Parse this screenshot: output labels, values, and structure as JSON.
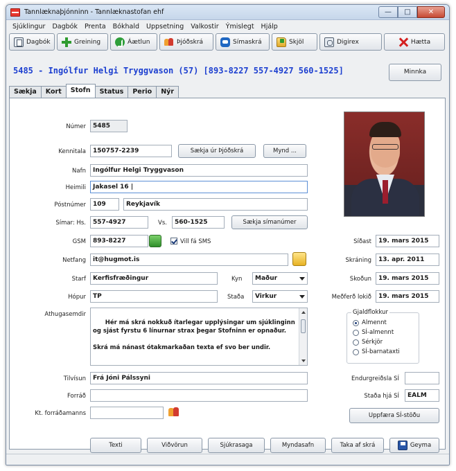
{
  "window": {
    "title": "Tannlæknaþjónninn - Tannlæknastofan ehf",
    "min": "—",
    "max": "□",
    "close": "✕"
  },
  "menu": [
    "Sjúklingur",
    "Dagbók",
    "Prenta",
    "Bókhald",
    "Uppsetning",
    "Valkostir",
    "Ýmislegt",
    "Hjálp"
  ],
  "toolbar": {
    "dagbok": "Dagbók",
    "greining": "Greining",
    "aaetlun": "Áætlun",
    "thjodskra": "Þjóðskrá",
    "simaskra": "Símaskrá",
    "skjol": "Skjöl",
    "digirex": "Digirex",
    "haetta": "Hætta"
  },
  "patient_header": "5485 - Ingólfur Helgi Tryggvason (57) [893-8227 557-4927 560-1525]",
  "minnka": "Minnka",
  "tabs": [
    "Sækja",
    "Kort",
    "Stofn",
    "Status",
    "Perio",
    "Nýr"
  ],
  "form": {
    "numer_label": "Númer",
    "numer": "5485",
    "kennitala_label": "Kennitala",
    "kennitala": "150757-2239",
    "saekja_thjodskra": "Sækja úr Þjóðskrá",
    "mynd": "Mynd ...",
    "nafn_label": "Nafn",
    "nafn": "Ingólfur Helgi Tryggvason",
    "heimili_label": "Heimili",
    "heimili": "Jakasel 16 |",
    "postnumer_label": "Póstnúmer",
    "postnumer": "109",
    "stadur": "Reykjavík",
    "simar_label": "Símar: Hs.",
    "hs": "557-4927",
    "vs_label": "Vs.",
    "vs": "560-1525",
    "saekja_simanumer": "Sækja símanúmer",
    "gsm_label": "GSM",
    "gsm": "893-8227",
    "sms_label": "Vill fá SMS",
    "netfang_label": "Netfang",
    "netfang": "it@hugmot.is",
    "starf_label": "Starf",
    "starf": "Kerfisfræðingur",
    "kyn_label": "Kyn",
    "kyn": "Maður",
    "hopur_label": "Hópur",
    "hopur": "TP",
    "stada_label": "Staða",
    "stada": "Virkur",
    "athugasemdir_label": "Athugasemdir",
    "athugasemdir": "Hér má skrá nokkuð ítarlegar upplýsingar um sjúklinginn og sjást fyrstu 6 línurnar strax þegar Stofninn er opnaður.\n\nSkrá má nánast ótakmarkaðan texta ef svo ber undir.",
    "tilvisun_label": "Tilvísun",
    "tilvisun": "Frá Jóni Pálssyni",
    "forradi_label": "Forráð",
    "forradi": "",
    "kt_forradamanns_label": "Kt. forráðamanns",
    "kt_forradamanns": ""
  },
  "right": {
    "sidast_label": "Síðast",
    "sidast": "19. mars 2015",
    "skraning_label": "Skráning",
    "skraning": "13. apr. 2011",
    "skodun_label": "Skoðun",
    "skodun": "19. mars 2015",
    "medferd_label": "Meðferð lokið",
    "medferd": "19. mars 2015",
    "gjaldflokkur_label": "Gjaldflokkur",
    "gjaldflokkur": [
      "Almennt",
      "SÍ-almennt",
      "Sérkjör",
      "SÍ-barnataxti"
    ],
    "endurgreidsla_label": "Endurgreiðsla SÍ",
    "endurgreidsla": "",
    "stada_si_label": "Staða hjá SÍ",
    "stada_si": "EALM",
    "uppfaera": "Uppfæra SÍ-stöðu"
  },
  "bottom": {
    "texti": "Texti",
    "vidvorun": "Viðvörun",
    "sjukrasaga": "Sjúkrasaga",
    "myndasafn": "Myndasafn",
    "taka_af_skra": "Taka af skrá",
    "geyma": "Geyma"
  }
}
